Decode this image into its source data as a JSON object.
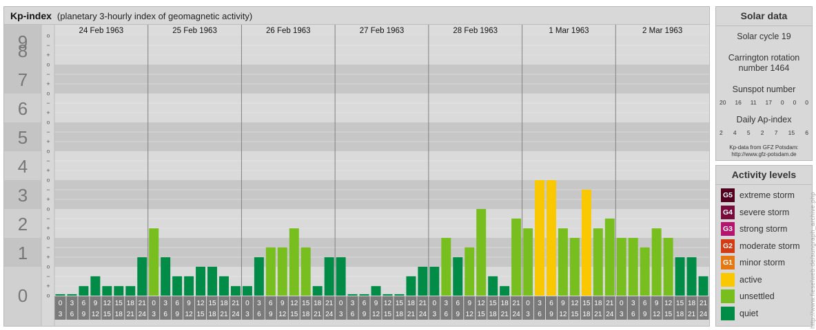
{
  "header": {
    "title": "Kp-index",
    "subtitle": "(planetary 3-hourly index of geomagnetic activity)"
  },
  "chart_data": {
    "type": "bar",
    "title": "Kp-index",
    "subtitle": "(planetary 3-hourly index of geomagnetic activity)",
    "ylim": [
      0,
      9
    ],
    "y_ticks": [
      "0",
      "1",
      "2",
      "3",
      "4",
      "5",
      "6",
      "7",
      "8",
      "9"
    ],
    "y_subticks": [
      "o",
      "+",
      "−"
    ],
    "days": [
      "24 Feb 1963",
      "25 Feb 1963",
      "26 Feb 1963",
      "27 Feb 1963",
      "28 Feb 1963",
      "1 Mar 1963",
      "2 Mar 1963"
    ],
    "interval_start": [
      "0",
      "3",
      "6",
      "9",
      "12",
      "15",
      "18",
      "21"
    ],
    "interval_end": [
      "3",
      "6",
      "9",
      "12",
      "15",
      "18",
      "21",
      "24"
    ],
    "values": [
      [
        0.0,
        0.0,
        0.33,
        0.67,
        0.33,
        0.33,
        0.33,
        1.33
      ],
      [
        2.33,
        1.33,
        0.67,
        0.67,
        1.0,
        1.0,
        0.67,
        0.33
      ],
      [
        0.33,
        1.33,
        1.67,
        1.67,
        2.33,
        1.67,
        0.33,
        1.33
      ],
      [
        1.33,
        0.0,
        0.0,
        0.33,
        0.0,
        0.0,
        0.67,
        1.0
      ],
      [
        1.0,
        2.0,
        1.33,
        1.67,
        3.0,
        0.67,
        0.33,
        2.67
      ],
      [
        2.33,
        4.0,
        4.0,
        2.33,
        2.0,
        3.67,
        2.33,
        2.67
      ],
      [
        2.0,
        2.0,
        1.67,
        2.33,
        2.0,
        1.33,
        1.33,
        0.67
      ]
    ],
    "colors": {
      "quiet": "#008c46",
      "unsettled": "#78be1e",
      "active": "#fac800",
      "grid_band_dark": "#c7c7c7",
      "grid_band_light": "#dadada"
    },
    "legend_placement": "right"
  },
  "solar": {
    "heading": "Solar data",
    "cycle": "Solar cycle 19",
    "carrington_line1": "Carrington rotation",
    "carrington_line2": "number 1464",
    "sunspot_label": "Sunspot number",
    "sunspot_values": [
      "20",
      "16",
      "11",
      "17",
      "0",
      "0",
      "0"
    ],
    "ap_label": "Daily Ap-index",
    "ap_values": [
      "2",
      "4",
      "5",
      "2",
      "7",
      "15",
      "6"
    ],
    "credit_line1": "Kp-data from GFZ Potsdam:",
    "credit_line2": "http://www.gfz-potsdam.de"
  },
  "activity": {
    "heading": "Activity levels",
    "levels": [
      {
        "code": "G5",
        "label": "extreme storm",
        "color": "#50001e"
      },
      {
        "code": "G4",
        "label": "severe storm",
        "color": "#780a3c"
      },
      {
        "code": "G3",
        "label": "strong storm",
        "color": "#b4146e"
      },
      {
        "code": "G2",
        "label": "moderate storm",
        "color": "#d23c14"
      },
      {
        "code": "G1",
        "label": "minor storm",
        "color": "#e67814"
      },
      {
        "code": "",
        "label": "active",
        "color": "#fac800"
      },
      {
        "code": "",
        "label": "unsettled",
        "color": "#78be1e"
      },
      {
        "code": "",
        "label": "quiet",
        "color": "#008c46"
      }
    ]
  },
  "watermark": "http://www.fieselweb.de/sungraph_archive.php"
}
